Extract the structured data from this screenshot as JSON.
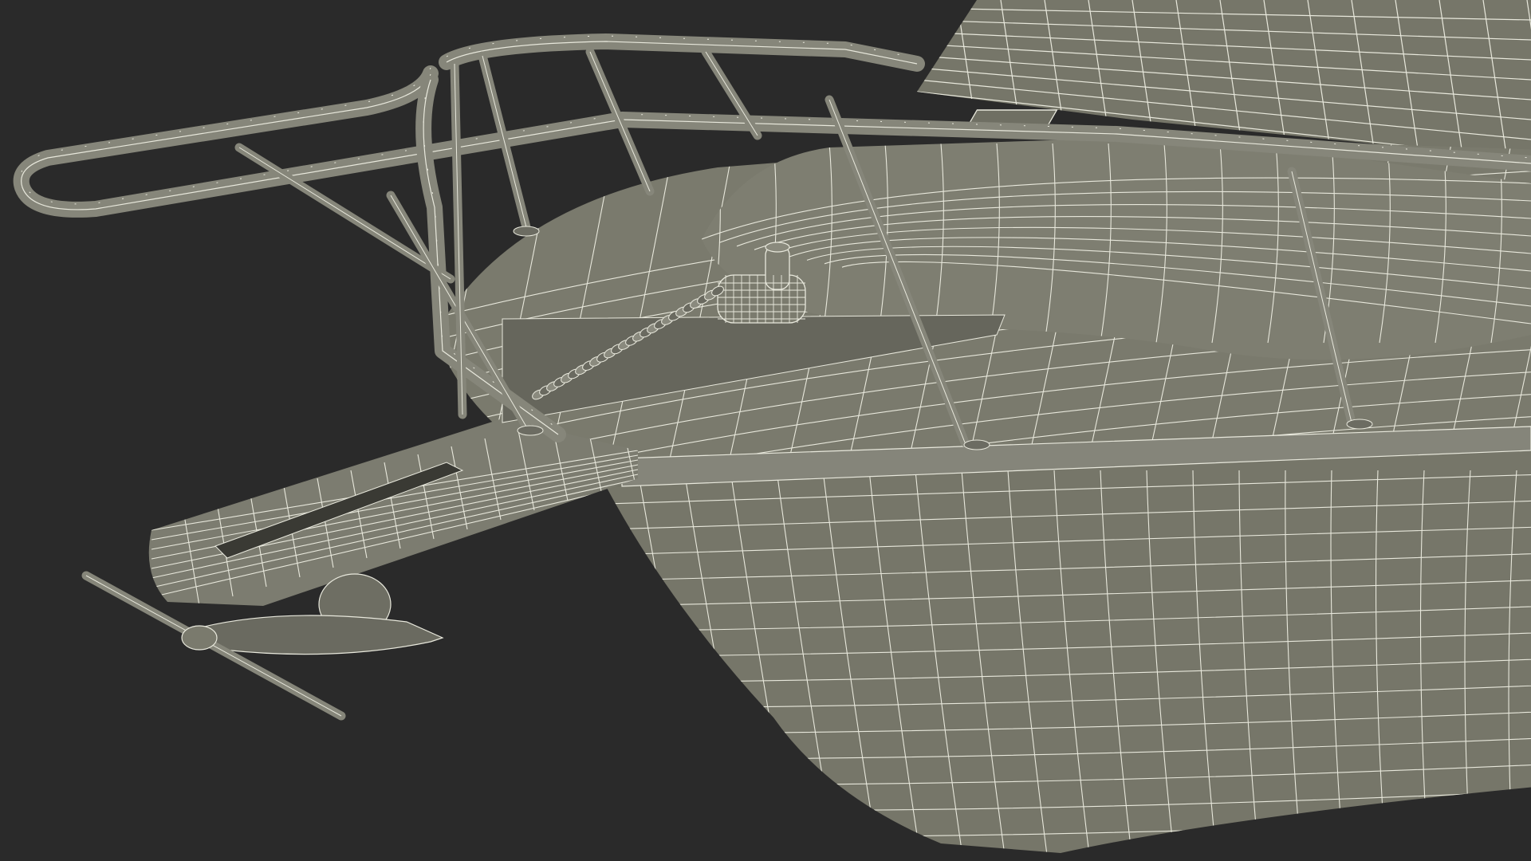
{
  "scene": {
    "subject": "boat-bow-wireframe",
    "colors": {
      "background": "#2a2a2a",
      "hull": "#767669",
      "hull_shadow": "#5c5c52",
      "hull_dark": "#4e4e46",
      "deck": "#7a7a6d",
      "wire": "#e8e8dc",
      "rail": "#86867a"
    }
  }
}
